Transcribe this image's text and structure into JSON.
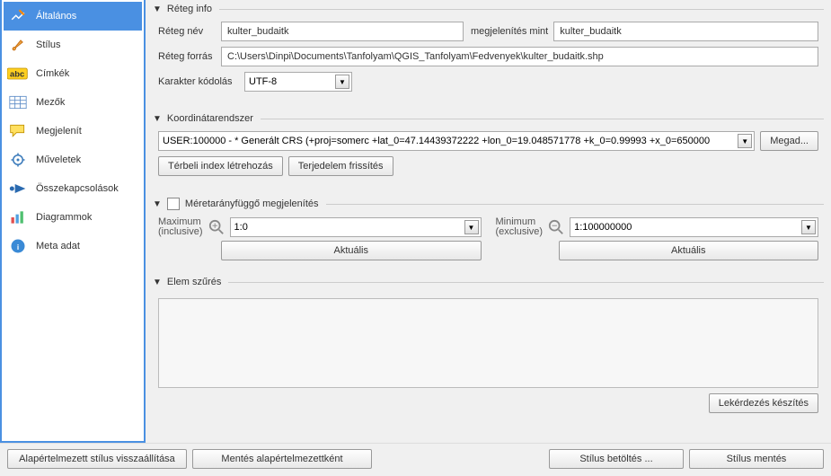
{
  "sidebar": {
    "items": [
      {
        "label": "Általános",
        "icon": "tools",
        "active": true
      },
      {
        "label": "Stílus",
        "icon": "brush"
      },
      {
        "label": "Címkék",
        "icon": "abc"
      },
      {
        "label": "Mezők",
        "icon": "table"
      },
      {
        "label": "Megjelenít",
        "icon": "speech"
      },
      {
        "label": "Műveletek",
        "icon": "gear"
      },
      {
        "label": "Összekapcsolások",
        "icon": "join"
      },
      {
        "label": "Diagrammok",
        "icon": "chart"
      },
      {
        "label": "Meta adat",
        "icon": "info"
      }
    ]
  },
  "layer_info": {
    "title": "Réteg info",
    "name_label": "Réteg név",
    "name_value": "kulter_budaitk",
    "display_as_label": "megjelenítés mint",
    "display_as_value": "kulter_budaitk",
    "source_label": "Réteg forrás",
    "source_value": "C:\\Users\\Dinpi\\Documents\\Tanfolyam\\QGIS_Tanfolyam\\Fedvenyek\\kulter_budaitk.shp",
    "encoding_label": "Karakter kódolás",
    "encoding_value": "UTF-8"
  },
  "crs": {
    "title": "Koordinátarendszer",
    "value": "USER:100000 -  * Generált CRS (+proj=somerc +lat_0=47.14439372222 +lon_0=19.048571778 +k_0=0.99993 +x_0=650000 ",
    "specify_button": "Megad...",
    "spatial_index_button": "Térbeli index létrehozás",
    "update_extent_button": "Terjedelem frissítés"
  },
  "scale": {
    "title": "Méretarányfüggő megjelenítés",
    "max_label_l1": "Maximum",
    "max_label_l2": "(inclusive)",
    "max_value": "1:0",
    "min_label_l1": "Minimum",
    "min_label_l2": "(exclusive)",
    "min_value": "1:100000000",
    "current_button": "Aktuális"
  },
  "filter": {
    "title": "Elem szűrés",
    "query_button": "Lekérdezés készítés"
  },
  "footer": {
    "restore_default": "Alapértelmezett stílus visszaállítása",
    "save_default": "Mentés alapértelmezettként",
    "load_style": "Stílus betöltés ...",
    "save_style": "Stílus mentés"
  }
}
